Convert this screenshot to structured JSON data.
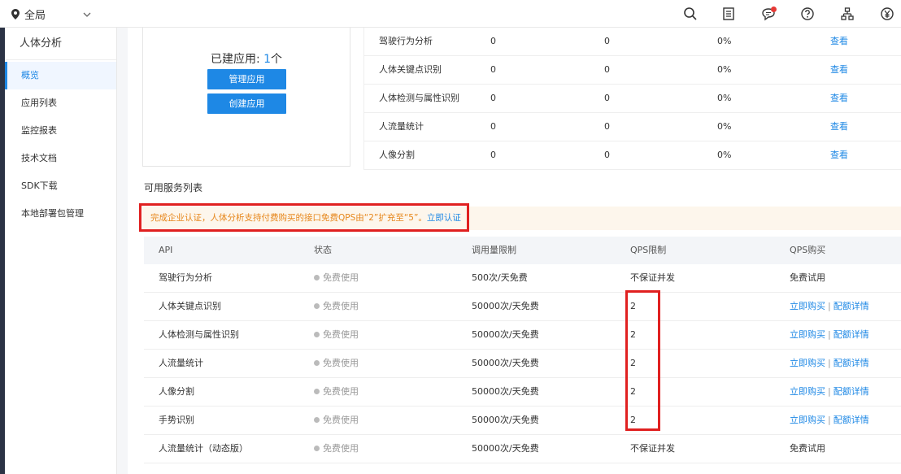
{
  "topbar": {
    "scope_label": "全局",
    "icons": [
      "search-icon",
      "document-icon",
      "message-icon",
      "help-icon",
      "org-chart-icon",
      "yuan-icon"
    ]
  },
  "sidebar": {
    "title": "人体分析",
    "items": [
      {
        "label": "概览",
        "active": true
      },
      {
        "label": "应用列表"
      },
      {
        "label": "监控报表"
      },
      {
        "label": "技术文档"
      },
      {
        "label": "SDK下载"
      },
      {
        "label": "本地部署包管理"
      }
    ]
  },
  "app_summary": {
    "created_label": "已建应用: ",
    "created_count": "1",
    "created_unit": "个",
    "manage_button": "管理应用",
    "create_button": "创建应用"
  },
  "usage_rows": [
    {
      "name": "驾驶行为分析",
      "v1": "0",
      "v2": "0",
      "pct": "0%",
      "action": "查看"
    },
    {
      "name": "人体关键点识别",
      "v1": "0",
      "v2": "0",
      "pct": "0%",
      "action": "查看"
    },
    {
      "name": "人体检测与属性识别",
      "v1": "0",
      "v2": "0",
      "pct": "0%",
      "action": "查看"
    },
    {
      "name": "人流量统计",
      "v1": "0",
      "v2": "0",
      "pct": "0%",
      "action": "查看"
    },
    {
      "name": "人像分割",
      "v1": "0",
      "v2": "0",
      "pct": "0%",
      "action": "查看"
    }
  ],
  "services": {
    "title": "可用服务列表",
    "notice": "完成企业认证，人体分析支持付费购买的接口免费QPS由“2”扩充至“5”。",
    "notice_link": "立即认证",
    "headers": [
      "API",
      "状态",
      "调用量限制",
      "QPS限制",
      "QPS购买"
    ],
    "rows": [
      {
        "api": "驾驶行为分析",
        "status": "免费使用",
        "limit": "500次/天免费",
        "qps": "不保证并发",
        "buy": "免费试用",
        "buy_link": "",
        "quota_link": ""
      },
      {
        "api": "人体关键点识别",
        "status": "免费使用",
        "limit": "50000次/天免费",
        "qps": "2",
        "buy": "",
        "buy_link": "立即购买",
        "quota_link": "配额详情"
      },
      {
        "api": "人体检测与属性识别",
        "status": "免费使用",
        "limit": "50000次/天免费",
        "qps": "2",
        "buy": "",
        "buy_link": "立即购买",
        "quota_link": "配额详情"
      },
      {
        "api": "人流量统计",
        "status": "免费使用",
        "limit": "50000次/天免费",
        "qps": "2",
        "buy": "",
        "buy_link": "立即购买",
        "quota_link": "配额详情"
      },
      {
        "api": "人像分割",
        "status": "免费使用",
        "limit": "50000次/天免费",
        "qps": "2",
        "buy": "",
        "buy_link": "立即购买",
        "quota_link": "配额详情"
      },
      {
        "api": "手势识别",
        "status": "免费使用",
        "limit": "50000次/天免费",
        "qps": "2",
        "buy": "",
        "buy_link": "立即购买",
        "quota_link": "配额详情"
      },
      {
        "api": "人流量统计（动态版）",
        "status": "免费使用",
        "limit": "50000次/天免费",
        "qps": "不保证并发",
        "buy": "免费试用",
        "buy_link": "",
        "quota_link": ""
      }
    ]
  }
}
